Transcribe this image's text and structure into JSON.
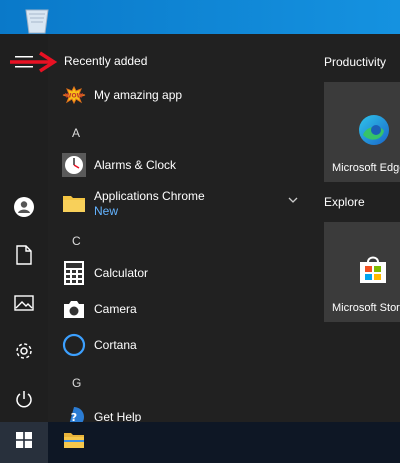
{
  "start_menu": {
    "recently_added_label": "Recently added",
    "recent_app": {
      "name": "My amazing app",
      "icon": "wow-badge-icon"
    },
    "sections": [
      {
        "letter": "A",
        "apps": [
          {
            "name": "Alarms & Clock",
            "icon": "alarm-clock-icon"
          },
          {
            "name": "Applications Chrome",
            "badge": "New",
            "icon": "folder-icon"
          }
        ]
      },
      {
        "letter": "C",
        "apps": [
          {
            "name": "Calculator",
            "icon": "calculator-icon"
          },
          {
            "name": "Camera",
            "icon": "camera-icon"
          },
          {
            "name": "Cortana",
            "icon": "cortana-icon"
          }
        ]
      },
      {
        "letter": "G",
        "apps": [
          {
            "name": "Get Help",
            "icon": "help-icon"
          }
        ]
      }
    ],
    "tile_groups": [
      {
        "title": "Productivity",
        "tiles": [
          {
            "name": "Microsoft Edge",
            "icon": "edge-icon"
          }
        ]
      },
      {
        "title": "Explore",
        "tiles": [
          {
            "name": "Microsoft Store",
            "icon": "store-icon"
          }
        ]
      }
    ]
  },
  "colors": {
    "accent": "#0078d7",
    "new_badge": "#63b3ff",
    "arrow": "#e81123",
    "tile_bg": "#3b3b3b"
  }
}
